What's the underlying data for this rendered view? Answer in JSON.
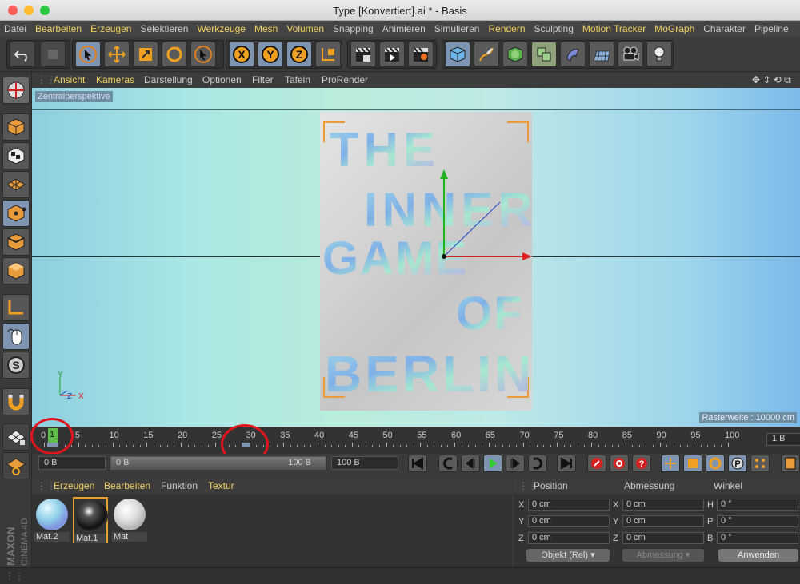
{
  "window": {
    "title": "Type [Konvertiert].ai * - Basis"
  },
  "menubar": {
    "items": [
      "Datei",
      "Bearbeiten",
      "Erzeugen",
      "Selektieren",
      "Werkzeuge",
      "Mesh",
      "Volumen",
      "Snapping",
      "Animieren",
      "Simulieren",
      "Rendern",
      "Sculpting",
      "Motion Tracker",
      "MoGraph",
      "Charakter",
      "Pipeline"
    ],
    "highlighted": [
      "Bearbeiten",
      "Erzeugen",
      "Werkzeuge",
      "Mesh",
      "Volumen",
      "Rendern",
      "Motion Tracker",
      "MoGraph"
    ]
  },
  "toolbar": {
    "axis_x": "X",
    "axis_y": "Y",
    "axis_z": "Z"
  },
  "viewport": {
    "menu": [
      "Ansicht",
      "Kameras",
      "Darstellung",
      "Optionen",
      "Filter",
      "Tafeln",
      "ProRender"
    ],
    "menu_highlighted": [
      "Ansicht",
      "Kameras"
    ],
    "label": "Zentralperspektive",
    "grid_spacing": "Rasterweite : 10000 cm",
    "poster_lines": [
      "THE",
      "INNER",
      "GAME",
      "OF",
      "BERLIN"
    ],
    "axis_gizmo": {
      "x": "X",
      "y": "Y",
      "z": "Z"
    }
  },
  "timeline": {
    "ticks": [
      "0",
      "5",
      "10",
      "15",
      "20",
      "25",
      "30",
      "35",
      "40",
      "45",
      "50",
      "55",
      "60",
      "65",
      "70",
      "75",
      "80",
      "85",
      "90",
      "95",
      "100"
    ],
    "current_frame_label": "1",
    "frame_field": "1 B",
    "playhead_frame": 0,
    "marker_frame": 30
  },
  "transport": {
    "start_field": "0 B",
    "range_start": "0 B",
    "range_end": "100 B",
    "end_field": "100 B"
  },
  "materials": {
    "tabs": [
      "Erzeugen",
      "Bearbeiten",
      "Funktion",
      "Textur"
    ],
    "tabs_highlighted": [
      "Erzeugen",
      "Bearbeiten",
      "Textur"
    ],
    "items": [
      {
        "name": "Mat.2"
      },
      {
        "name": "Mat.1"
      },
      {
        "name": "Mat"
      }
    ]
  },
  "attributes": {
    "headers": [
      "Position",
      "Abmessung",
      "Winkel"
    ],
    "position": [
      {
        "axis": "X",
        "value": "0 cm"
      },
      {
        "axis": "Y",
        "value": "0 cm"
      },
      {
        "axis": "Z",
        "value": "0 cm"
      }
    ],
    "size": [
      {
        "axis": "X",
        "value": "0 cm"
      },
      {
        "axis": "Y",
        "value": "0 cm"
      },
      {
        "axis": "Z",
        "value": "0 cm"
      }
    ],
    "rotation": [
      {
        "axis": "H",
        "value": "0 °"
      },
      {
        "axis": "P",
        "value": "0 °"
      },
      {
        "axis": "B",
        "value": "0 °"
      }
    ],
    "mode_dropdown": "Objekt (Rel)",
    "size_dropdown": "Abmessung",
    "apply_button": "Anwenden"
  },
  "branding": {
    "vendor": "MAXON",
    "product": "CINEMA 4D"
  },
  "colors": {
    "accent": "#f0d060",
    "active_button": "#7f94b0",
    "marker_circle": "#e0151b",
    "panel": "#333333"
  }
}
